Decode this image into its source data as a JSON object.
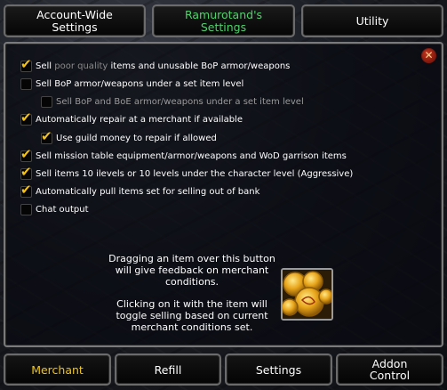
{
  "top_tabs": [
    {
      "line1": "Account-Wide",
      "line2": "Settings"
    },
    {
      "line1": "Ramurotand's",
      "line2": "Settings"
    },
    {
      "line1": "Utility",
      "line2": ""
    }
  ],
  "close_label": "✕",
  "options": [
    {
      "label_a": "Sell ",
      "label_gray": "poor quality",
      "label_b": " items and unusable BoP armor/weapons",
      "checked": true
    },
    {
      "label": "Sell BoP armor/weapons under a set item level",
      "checked": false
    },
    {
      "label": "Sell BoP and BoE armor/weapons under a set item level",
      "checked": false
    },
    {
      "label": "Automatically repair at a merchant if available",
      "checked": true
    },
    {
      "label": "Use guild money to repair if allowed",
      "checked": true
    },
    {
      "label": "Sell mission table equipment/armor/weapons and WoD garrison items",
      "checked": true
    },
    {
      "label": "Sell items 10 ilevels or 10 levels under the character level (Aggressive)",
      "checked": true
    },
    {
      "label": "Automatically pull items set for selling out of bank",
      "checked": true
    },
    {
      "label": "Chat output",
      "checked": false
    }
  ],
  "hint": {
    "para1": "Dragging an item over this button will give feedback on merchant conditions.",
    "para2": "Clicking on it with the item will toggle selling based on current merchant conditions set."
  },
  "bottom_tabs": [
    {
      "line1": "Merchant",
      "line2": ""
    },
    {
      "line1": "Refill",
      "line2": ""
    },
    {
      "line1": "Settings",
      "line2": ""
    },
    {
      "line1": "Addon",
      "line2": "Control"
    }
  ],
  "colors": {
    "active_top_tab": "#4fd16c",
    "active_bottom_tab": "#f0c419",
    "checkmark": "#f2c21a"
  }
}
